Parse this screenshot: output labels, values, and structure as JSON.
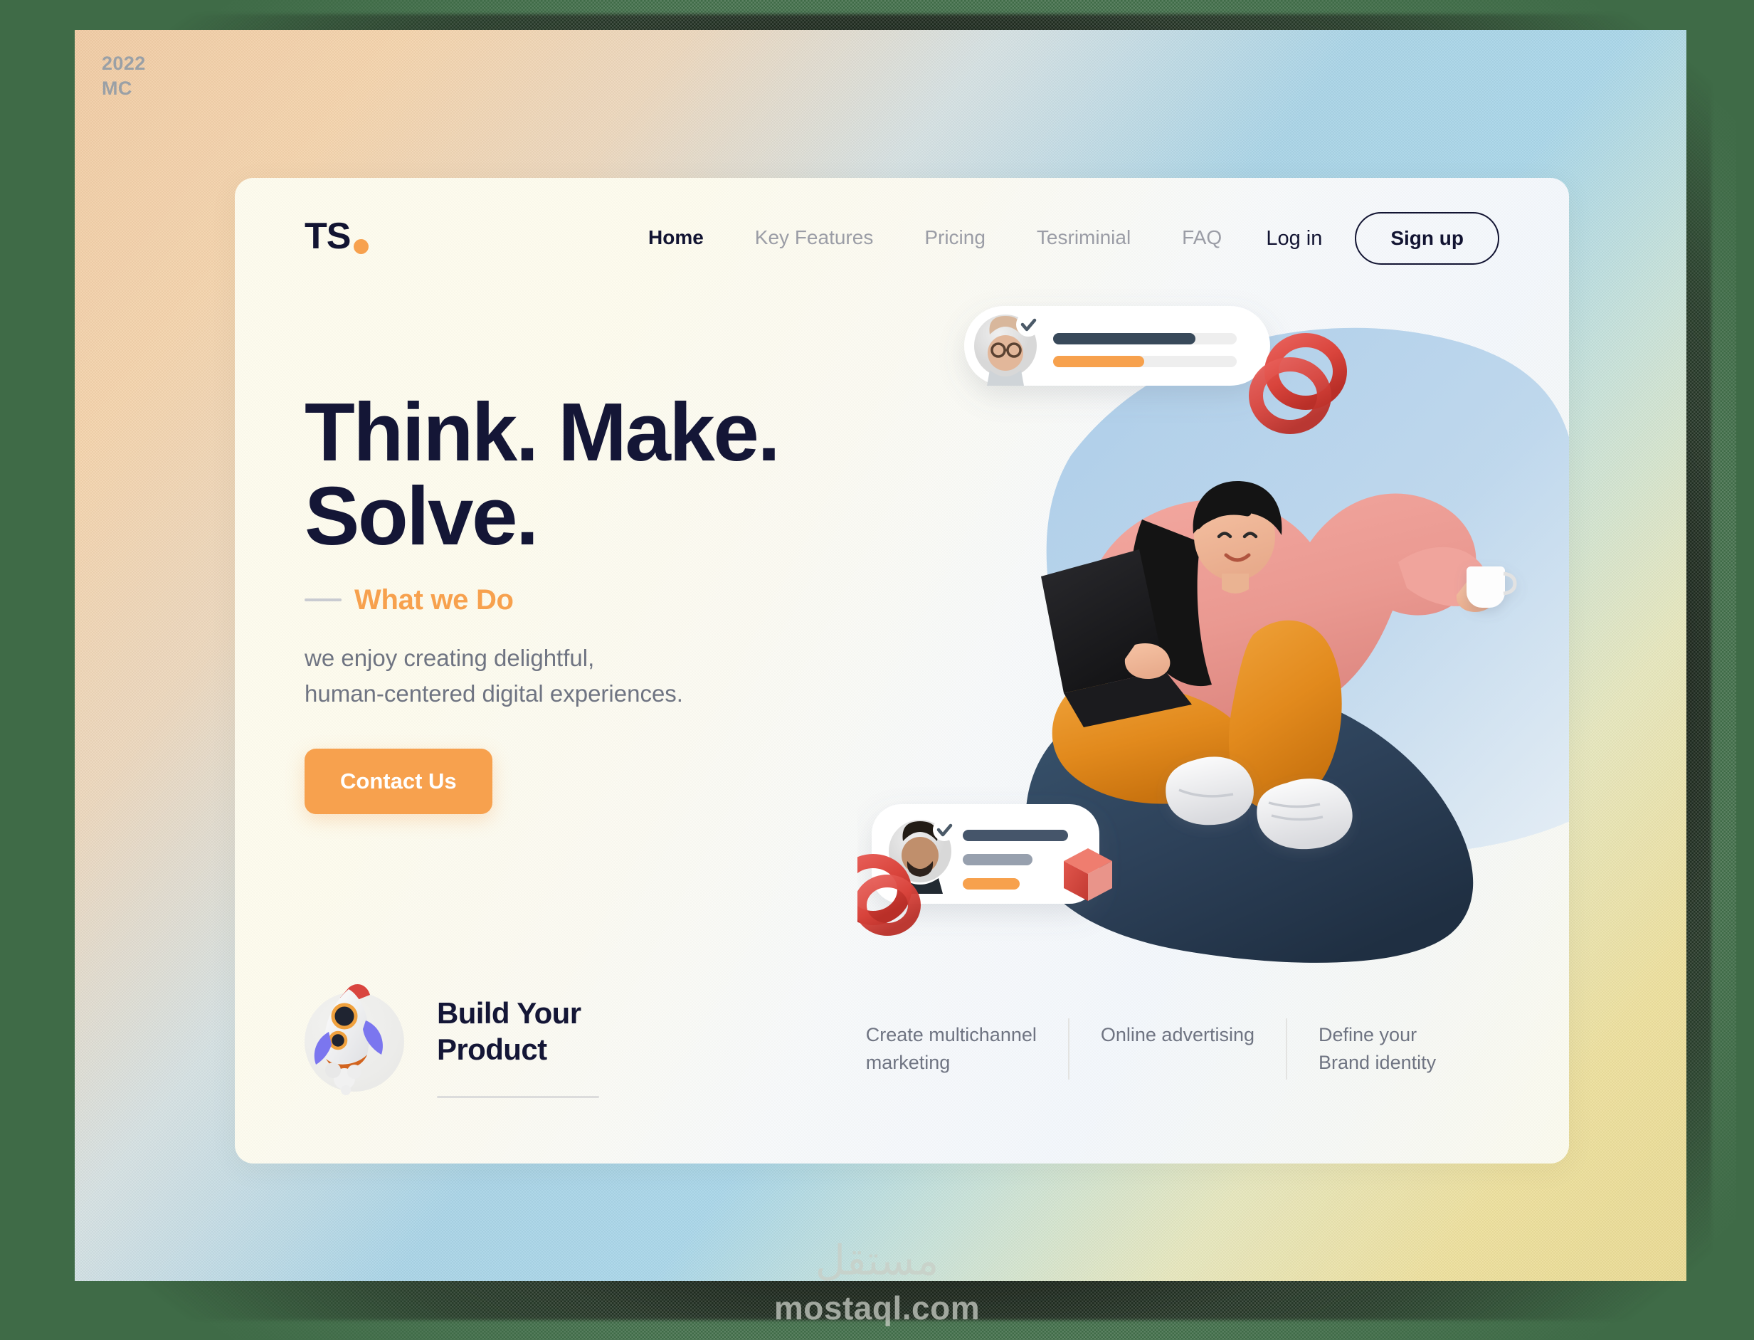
{
  "frame": {
    "corner_tag_year": "2022",
    "corner_tag_code": "MC"
  },
  "header": {
    "logo_text": "TS",
    "logo_dot": "orange-dot",
    "nav": [
      {
        "label": "Home",
        "active": true
      },
      {
        "label": "Key Features",
        "active": false
      },
      {
        "label": "Pricing",
        "active": false
      },
      {
        "label": "Tesriminial",
        "active": false
      },
      {
        "label": "FAQ",
        "active": false
      }
    ],
    "login_label": "Log in",
    "signup_label": "Sign up"
  },
  "hero": {
    "headline_line1": "Think. Make.",
    "headline_line2": "Solve.",
    "eyebrow": "What we Do",
    "subtitle_line1": "we enjoy creating delightful,",
    "subtitle_line2": "human-centered digital experiences.",
    "cta_label": "Contact Us"
  },
  "build": {
    "title": "Build Your\nProduct",
    "icon": "rocket-icon"
  },
  "features": [
    {
      "text": "Create multichannel\nmarketing"
    },
    {
      "text": "Online advertising"
    },
    {
      "text": "Define your\nBrand identity"
    }
  ],
  "illustration": {
    "name": "person-on-beanbag-with-laptop",
    "chat_card_top": {
      "avatar": "man-with-glasses-avatar",
      "verified": true,
      "bars": [
        "navy",
        "orange"
      ]
    },
    "chat_card_bottom": {
      "avatar": "bearded-man-avatar",
      "verified": true,
      "bars": [
        "navy",
        "gray",
        "orange"
      ]
    },
    "props": [
      "red-spiral-torus",
      "red-cube",
      "white-coffee-cup",
      "black-laptop"
    ]
  },
  "watermark": {
    "arabic": "مستقل",
    "latin": "mostaql.com"
  },
  "colors": {
    "ink": "#141636",
    "accent_orange": "#f7a14e",
    "muted": "#6f7482",
    "beanbag_navy": "#2b4055",
    "sweater_pink": "#ef9a94",
    "pants_orange": "#e8901f",
    "prop_red": "#d9443c"
  }
}
